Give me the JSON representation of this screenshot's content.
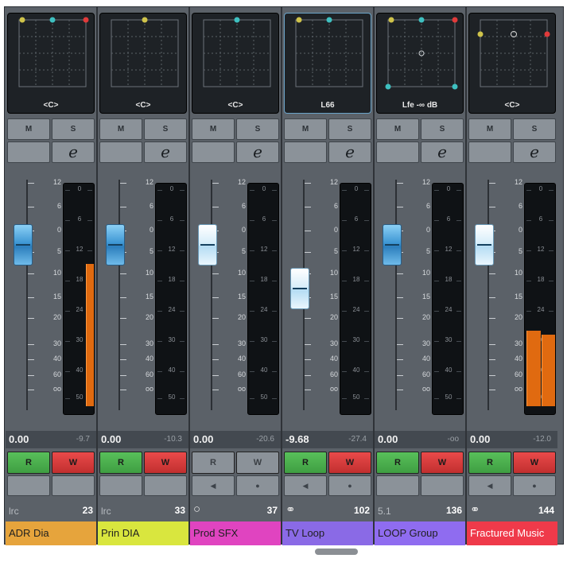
{
  "fader_scale_labels": [
    "12",
    "6",
    "0",
    "5",
    "10",
    "15",
    "20",
    "30",
    "40",
    "60",
    "oo"
  ],
  "meter_scale_labels": [
    "0",
    "6",
    "12",
    "18",
    "24",
    "30",
    "40",
    "50"
  ],
  "buttons": {
    "mute": "M",
    "solo": "S",
    "edit": "e",
    "read": "R",
    "write": "W"
  },
  "channels": [
    {
      "pan_label": "<C>",
      "selected": false,
      "dots": [
        "#cfc34a",
        "#3ec0c0",
        "#e03a3a"
      ],
      "fader_db": "0.00",
      "fader_level": 0.27,
      "cap": "blue",
      "peak": "-9.7",
      "meter_levels": [
        0.64
      ],
      "rw_active": true,
      "sub_buttons": false,
      "type": "lrc",
      "type_icon": "",
      "number": "23",
      "name": "ADR Dia",
      "color": "#e6a43c"
    },
    {
      "pan_label": "<C>",
      "selected": false,
      "dots": [
        "#cfc34a"
      ],
      "fader_db": "0.00",
      "fader_level": 0.27,
      "cap": "blue",
      "peak": "-10.3",
      "meter_levels": [],
      "rw_active": true,
      "sub_buttons": false,
      "type": "lrc",
      "type_icon": "",
      "number": "33",
      "name": "Prin DIA",
      "color": "#d9e63e"
    },
    {
      "pan_label": "<C>",
      "selected": false,
      "dots": [
        "#3ec0c0"
      ],
      "fader_db": "0.00",
      "fader_level": 0.27,
      "cap": "light",
      "peak": "-20.6",
      "meter_levels": [],
      "rw_active": false,
      "sub_buttons": true,
      "type": "",
      "type_icon": "mono-icon",
      "number": "37",
      "name": "Prod SFX",
      "color": "#e044c0"
    },
    {
      "pan_label": "L66",
      "selected": true,
      "dots": [
        "#cfc34a",
        "#3ec0c0"
      ],
      "fader_db": "-9.68",
      "fader_level": 0.46,
      "cap": "light",
      "peak": "-27.4",
      "meter_levels": [],
      "rw_active": true,
      "sub_buttons": true,
      "type": "",
      "type_icon": "stereo-icon",
      "number": "102",
      "name": "TV Loop",
      "color": "#8a6ae6"
    },
    {
      "pan_label": "Lfe -∞ dB",
      "selected": false,
      "dots": [
        "#cfc34a",
        "#3ec0c0",
        "#e03a3a",
        "#3ec0c0",
        "#3ec0c0"
      ],
      "fader_db": "0.00",
      "fader_level": 0.27,
      "cap": "blue",
      "peak": "-oo",
      "meter_levels": [],
      "rw_active": true,
      "sub_buttons": false,
      "type": "5.1",
      "type_icon": "",
      "number": "136",
      "name": "LOOP Group",
      "color": "#8f6cf0"
    },
    {
      "pan_label": "<C>",
      "selected": false,
      "dots": [
        "#cfc34a",
        "#d8d8d8",
        "#e03a3a"
      ],
      "fader_db": "0.00",
      "fader_level": 0.27,
      "cap": "light",
      "peak": "-12.0",
      "meter_levels": [
        0.34,
        0.32
      ],
      "rw_active": true,
      "sub_buttons": true,
      "type": "",
      "type_icon": "stereo-icon",
      "number": "144",
      "name": "Fractured Music",
      "color": "#ef3a4a"
    }
  ]
}
